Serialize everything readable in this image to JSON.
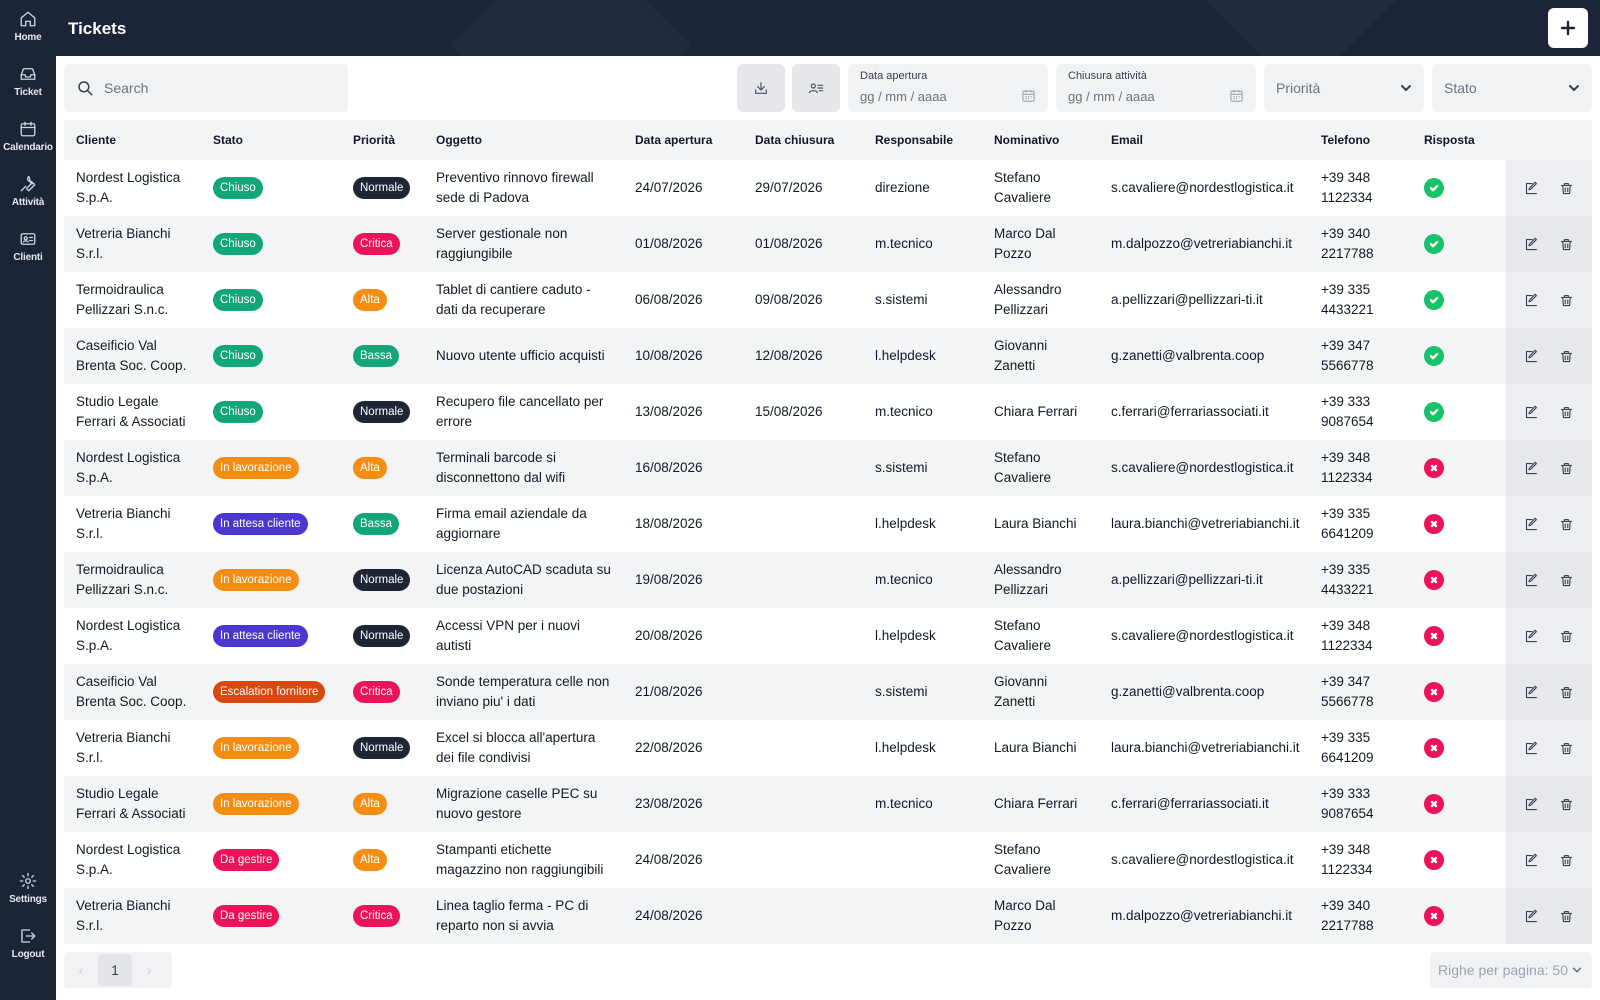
{
  "sidebar": {
    "items": [
      {
        "label": "Home",
        "icon": "home-icon"
      },
      {
        "label": "Ticket",
        "icon": "inbox-icon"
      },
      {
        "label": "Calendario",
        "icon": "calendar-icon"
      },
      {
        "label": "Attività",
        "icon": "wrench-icon"
      },
      {
        "label": "Clienti",
        "icon": "id-card-icon"
      }
    ],
    "bottom_items": [
      {
        "label": "Settings",
        "icon": "gear-icon"
      },
      {
        "label": "Logout",
        "icon": "logout-icon"
      }
    ]
  },
  "header": {
    "title": "Tickets",
    "add_icon": "plus-icon"
  },
  "toolbar": {
    "search_placeholder": "Search",
    "download_icon": "download-icon",
    "contacts_icon": "contacts-icon",
    "data_apertura": {
      "label": "Data apertura",
      "placeholder": "gg / mm / aaaa"
    },
    "chiusura_attivita": {
      "label": "Chiusura attività",
      "placeholder": "gg / mm / aaaa"
    },
    "priorita": "Priorità",
    "stato": "Stato"
  },
  "colors": {
    "Chiuso": "#13a679",
    "In lavorazione": "#f58d12",
    "In attesa cliente": "#4a37d0",
    "Escalation fornitore": "#d9480f",
    "Da gestire": "#ee1259",
    "Normale": "#1e2535",
    "Critica": "#ee1259",
    "Alta": "#f58d12",
    "Bassa": "#13a679",
    "risposta_ok": "#18c26b",
    "risposta_no": "#ee1259"
  },
  "table": {
    "columns": [
      "Cliente",
      "Stato",
      "Priorità",
      "Oggetto",
      "Data apertura",
      "Data chiusura",
      "Responsabile",
      "Nominativo",
      "Email",
      "Telefono",
      "Risposta"
    ],
    "rows": [
      {
        "cliente": [
          "Nordest Logistica",
          "S.p.A."
        ],
        "stato": "Chiuso",
        "priorita": "Normale",
        "oggetto": [
          "Preventivo rinnovo firewall",
          "sede di Padova"
        ],
        "apertura": "24/07/2026",
        "chiusura": "29/07/2026",
        "responsabile": "direzione",
        "nominativo": [
          "Stefano",
          "Cavaliere"
        ],
        "email": "s.cavaliere@nordestlogistica.it",
        "telefono": [
          "+39 348",
          "1122334"
        ],
        "risposta": true
      },
      {
        "cliente": [
          "Vetreria Bianchi",
          "S.r.l."
        ],
        "stato": "Chiuso",
        "priorita": "Critica",
        "oggetto": [
          "Server gestionale non",
          "raggiungibile"
        ],
        "apertura": "01/08/2026",
        "chiusura": "01/08/2026",
        "responsabile": "m.tecnico",
        "nominativo": [
          "Marco Dal",
          "Pozzo"
        ],
        "email": "m.dalpozzo@vetreriabianchi.it",
        "telefono": [
          "+39 340",
          "2217788"
        ],
        "risposta": true
      },
      {
        "cliente": [
          "Termoidraulica",
          "Pellizzari S.n.c."
        ],
        "stato": "Chiuso",
        "priorita": "Alta",
        "oggetto": [
          "Tablet di cantiere caduto -",
          "dati da recuperare"
        ],
        "apertura": "06/08/2026",
        "chiusura": "09/08/2026",
        "responsabile": "s.sistemi",
        "nominativo": [
          "Alessandro",
          "Pellizzari"
        ],
        "email": "a.pellizzari@pellizzari-ti.it",
        "telefono": [
          "+39 335",
          "4433221"
        ],
        "risposta": true
      },
      {
        "cliente": [
          "Caseificio Val",
          "Brenta Soc. Coop."
        ],
        "stato": "Chiuso",
        "priorita": "Bassa",
        "oggetto": [
          "Nuovo utente ufficio acquisti"
        ],
        "apertura": "10/08/2026",
        "chiusura": "12/08/2026",
        "responsabile": "l.helpdesk",
        "nominativo": [
          "Giovanni",
          "Zanetti"
        ],
        "email": "g.zanetti@valbrenta.coop",
        "telefono": [
          "+39 347",
          "5566778"
        ],
        "risposta": true
      },
      {
        "cliente": [
          "Studio Legale",
          "Ferrari & Associati"
        ],
        "stato": "Chiuso",
        "priorita": "Normale",
        "oggetto": [
          "Recupero file cancellato per",
          "errore"
        ],
        "apertura": "13/08/2026",
        "chiusura": "15/08/2026",
        "responsabile": "m.tecnico",
        "nominativo": [
          "Chiara Ferrari"
        ],
        "email": "c.ferrari@ferrariassociati.it",
        "telefono": [
          "+39 333",
          "9087654"
        ],
        "risposta": true
      },
      {
        "cliente": [
          "Nordest Logistica",
          "S.p.A."
        ],
        "stato": "In lavorazione",
        "priorita": "Alta",
        "oggetto": [
          "Terminali barcode si",
          "disconnettono dal wifi"
        ],
        "apertura": "16/08/2026",
        "chiusura": "",
        "responsabile": "s.sistemi",
        "nominativo": [
          "Stefano",
          "Cavaliere"
        ],
        "email": "s.cavaliere@nordestlogistica.it",
        "telefono": [
          "+39 348",
          "1122334"
        ],
        "risposta": false
      },
      {
        "cliente": [
          "Vetreria Bianchi",
          "S.r.l."
        ],
        "stato": "In attesa cliente",
        "priorita": "Bassa",
        "oggetto": [
          "Firma email aziendale da",
          "aggiornare"
        ],
        "apertura": "18/08/2026",
        "chiusura": "",
        "responsabile": "l.helpdesk",
        "nominativo": [
          "Laura Bianchi"
        ],
        "email": "laura.bianchi@vetreriabianchi.it",
        "telefono": [
          "+39 335",
          "6641209"
        ],
        "risposta": false
      },
      {
        "cliente": [
          "Termoidraulica",
          "Pellizzari S.n.c."
        ],
        "stato": "In lavorazione",
        "priorita": "Normale",
        "oggetto": [
          "Licenza AutoCAD scaduta su",
          "due postazioni"
        ],
        "apertura": "19/08/2026",
        "chiusura": "",
        "responsabile": "m.tecnico",
        "nominativo": [
          "Alessandro",
          "Pellizzari"
        ],
        "email": "a.pellizzari@pellizzari-ti.it",
        "telefono": [
          "+39 335",
          "4433221"
        ],
        "risposta": false
      },
      {
        "cliente": [
          "Nordest Logistica",
          "S.p.A."
        ],
        "stato": "In attesa cliente",
        "priorita": "Normale",
        "oggetto": [
          "Accessi VPN per i nuovi",
          "autisti"
        ],
        "apertura": "20/08/2026",
        "chiusura": "",
        "responsabile": "l.helpdesk",
        "nominativo": [
          "Stefano",
          "Cavaliere"
        ],
        "email": "s.cavaliere@nordestlogistica.it",
        "telefono": [
          "+39 348",
          "1122334"
        ],
        "risposta": false
      },
      {
        "cliente": [
          "Caseificio Val",
          "Brenta Soc. Coop."
        ],
        "stato": "Escalation fornitore",
        "priorita": "Critica",
        "oggetto": [
          "Sonde temperatura celle non",
          "inviano piu' i dati"
        ],
        "apertura": "21/08/2026",
        "chiusura": "",
        "responsabile": "s.sistemi",
        "nominativo": [
          "Giovanni",
          "Zanetti"
        ],
        "email": "g.zanetti@valbrenta.coop",
        "telefono": [
          "+39 347",
          "5566778"
        ],
        "risposta": false
      },
      {
        "cliente": [
          "Vetreria Bianchi",
          "S.r.l."
        ],
        "stato": "In lavorazione",
        "priorita": "Normale",
        "oggetto": [
          "Excel si blocca all'apertura",
          "dei file condivisi"
        ],
        "apertura": "22/08/2026",
        "chiusura": "",
        "responsabile": "l.helpdesk",
        "nominativo": [
          "Laura Bianchi"
        ],
        "email": "laura.bianchi@vetreriabianchi.it",
        "telefono": [
          "+39 335",
          "6641209"
        ],
        "risposta": false
      },
      {
        "cliente": [
          "Studio Legale",
          "Ferrari & Associati"
        ],
        "stato": "In lavorazione",
        "priorita": "Alta",
        "oggetto": [
          "Migrazione caselle PEC su",
          "nuovo gestore"
        ],
        "apertura": "23/08/2026",
        "chiusura": "",
        "responsabile": "m.tecnico",
        "nominativo": [
          "Chiara Ferrari"
        ],
        "email": "c.ferrari@ferrariassociati.it",
        "telefono": [
          "+39 333",
          "9087654"
        ],
        "risposta": false
      },
      {
        "cliente": [
          "Nordest Logistica",
          "S.p.A."
        ],
        "stato": "Da gestire",
        "priorita": "Alta",
        "oggetto": [
          "Stampanti etichette",
          "magazzino non raggiungibili"
        ],
        "apertura": "24/08/2026",
        "chiusura": "",
        "responsabile": "",
        "nominativo": [
          "Stefano",
          "Cavaliere"
        ],
        "email": "s.cavaliere@nordestlogistica.it",
        "telefono": [
          "+39 348",
          "1122334"
        ],
        "risposta": false
      },
      {
        "cliente": [
          "Vetreria Bianchi",
          "S.r.l."
        ],
        "stato": "Da gestire",
        "priorita": "Critica",
        "oggetto": [
          "Linea taglio ferma - PC di",
          "reparto non si avvia"
        ],
        "apertura": "24/08/2026",
        "chiusura": "",
        "responsabile": "",
        "nominativo": [
          "Marco Dal",
          "Pozzo"
        ],
        "email": "m.dalpozzo@vetreriabianchi.it",
        "telefono": [
          "+39 340",
          "2217788"
        ],
        "risposta": false
      }
    ]
  },
  "footer": {
    "current_page": "1",
    "rows_per_page": "Righe per pagina: 50"
  }
}
